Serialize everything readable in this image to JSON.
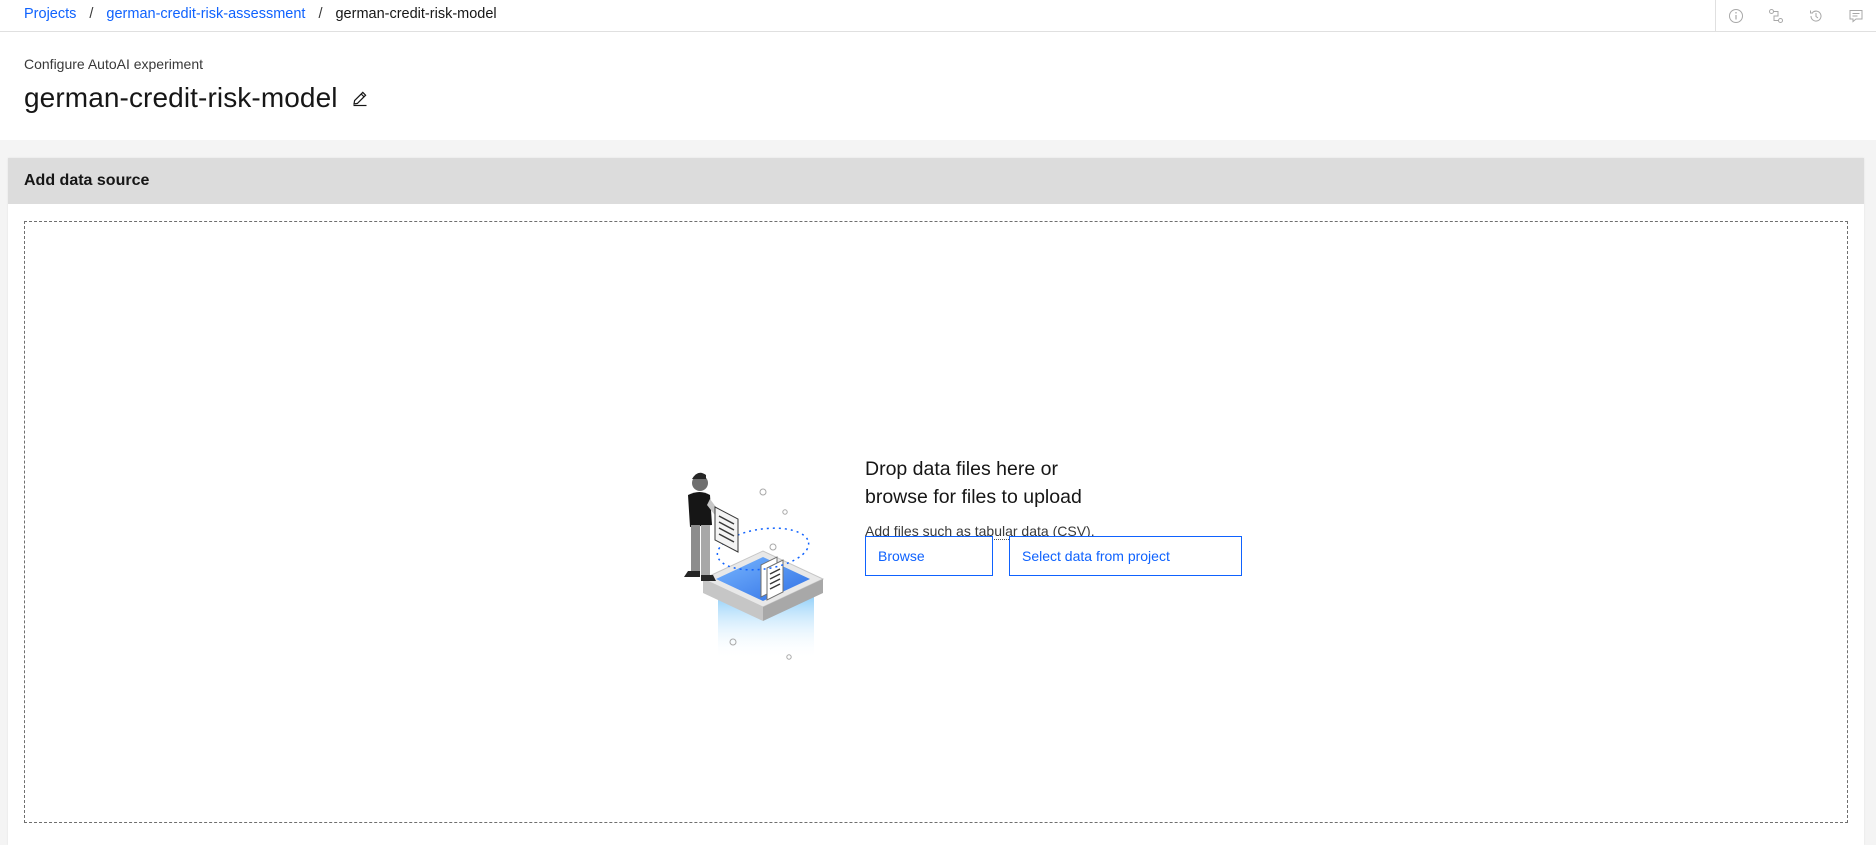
{
  "breadcrumb": {
    "projects": "Projects",
    "project": "german-credit-risk-assessment",
    "current": "german-credit-risk-model"
  },
  "toolbar": {
    "icons": [
      "info-icon",
      "pipeline-icon",
      "history-icon",
      "comment-icon"
    ]
  },
  "header": {
    "subtitle": "Configure AutoAI experiment",
    "title": "german-credit-risk-model"
  },
  "panel": {
    "title": "Add data source"
  },
  "dropzone": {
    "heading_line1": "Drop data files here or",
    "heading_line2": "browse for files to upload",
    "help_prefix": "Add files such as ",
    "help_link": "tabular data",
    "help_suffix": " (CSV).",
    "browse_label": "Browse",
    "select_label": "Select data from project"
  },
  "colors": {
    "link": "#0f62fe",
    "panel_header": "#dcdcdc",
    "background": "#f4f4f4"
  }
}
